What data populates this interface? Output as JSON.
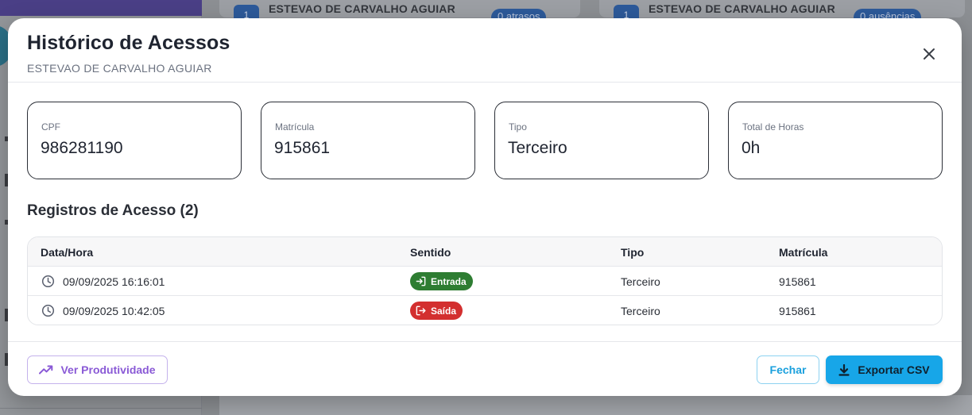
{
  "background": {
    "cards": [
      {
        "num": "1",
        "name": "ESTEVAO DE CARVALHO AGUIAR",
        "pill": "0 atrasos"
      },
      {
        "num": "1",
        "name": "ESTEVAO DE CARVALHO AGUIAR",
        "pill": "0 ausências"
      }
    ]
  },
  "modal": {
    "title": "Histórico de Acessos",
    "subtitle": "ESTEVAO DE CARVALHO AGUIAR",
    "stats": [
      {
        "label": "CPF",
        "value": "986281190"
      },
      {
        "label": "Matrícula",
        "value": "915861"
      },
      {
        "label": "Tipo",
        "value": "Terceiro"
      },
      {
        "label": "Total de Horas",
        "value": "0h"
      }
    ],
    "section_title": "Registros de Acesso (2)",
    "table": {
      "headers": [
        "Data/Hora",
        "Sentido",
        "Tipo",
        "Matrícula"
      ],
      "rows": [
        {
          "datetime": "09/09/2025 16:16:01",
          "direction": "Entrada",
          "type": "Terceiro",
          "registration": "915861"
        },
        {
          "datetime": "09/09/2025 10:42:05",
          "direction": "Saída",
          "type": "Terceiro",
          "registration": "915861"
        }
      ]
    },
    "footer": {
      "productivity_label": "Ver Produtividade",
      "close_label": "Fechar",
      "export_label": "Exportar CSV"
    }
  },
  "colors": {
    "entry_badge": "#2e7d32",
    "exit_badge": "#d32f2f",
    "accent_purple": "#8a5ad6",
    "accent_blue": "#17a6e8"
  },
  "icons": {
    "close": "close-icon",
    "clock": "clock-icon",
    "entry": "login-icon",
    "exit": "logout-icon",
    "trend": "trending-up-icon",
    "download": "download-icon"
  }
}
